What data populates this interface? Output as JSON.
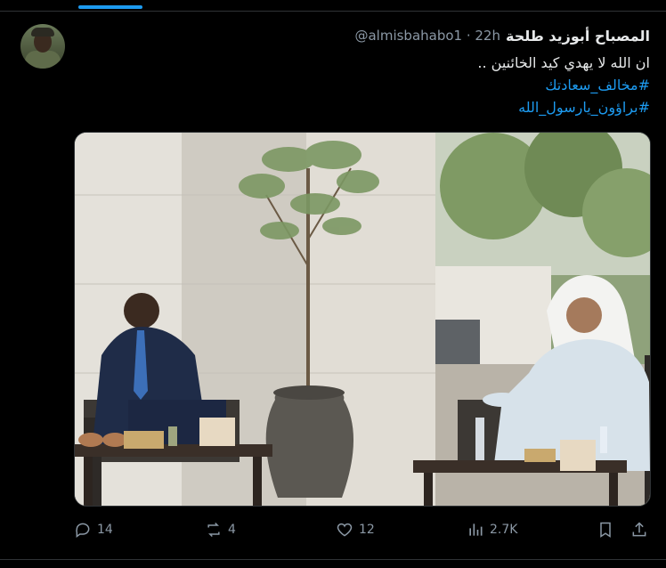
{
  "tweet": {
    "author_name": "المصباح أبوزيد طلحة",
    "author_handle": "@almisbahabo1 · 22h",
    "text_line": "ان الله لا يهدي كيد الخائنين ..",
    "hashtags": [
      "#مخالف_سعادتك",
      "#براؤون_يارسول_الله"
    ]
  },
  "actions": {
    "replies": "14",
    "reposts": "4",
    "likes": "12",
    "views": "2.7K"
  },
  "colors": {
    "background": "#000000",
    "text": "#e7e9ea",
    "muted": "#8b98a5",
    "link": "#1d9bf0"
  },
  "icons": {
    "reply": "reply-icon",
    "repost": "repost-icon",
    "like": "heart-icon",
    "views": "views-icon",
    "bookmark": "bookmark-icon",
    "share": "share-icon"
  }
}
